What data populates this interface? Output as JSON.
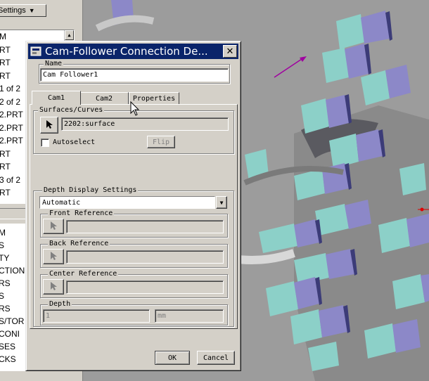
{
  "tree": {
    "settings_label": "Settings",
    "items": [
      "M",
      "RT",
      "RT",
      "RT",
      "1 of 2",
      "2 of 2",
      "2.PRT",
      "2.PRT",
      "2.PRT",
      "RT",
      "RT",
      "3 of 2",
      "RT"
    ],
    "lower_items": [
      "M",
      "S",
      "TY",
      "CTION",
      "RS",
      "S",
      "RS",
      "S/TOR",
      "CONI",
      "SES",
      "CKS"
    ]
  },
  "dialog": {
    "title": "Cam-Follower Connection De...",
    "name_label": "Name",
    "name_value": "Cam Follower1",
    "tabs": [
      "Cam1",
      "Cam2",
      "Properties"
    ],
    "surfaces_label": "Surfaces/Curves",
    "surface_value": "2202:surface",
    "autoselect_label": "Autoselect",
    "flip_label": "Flip",
    "depth_display_label": "Depth Display Settings",
    "depth_display_value": "Automatic",
    "front_ref_label": "Front Reference",
    "back_ref_label": "Back Reference",
    "center_ref_label": "Center Reference",
    "depth_label": "Depth",
    "depth_value": "1",
    "depth_unit": "mm",
    "ok_label": "OK",
    "cancel_label": "Cancel"
  },
  "colors": {
    "titlebar": "#0a246a",
    "viewport_bg": "#9c9c9c",
    "model_light": "#8cd0c8",
    "model_purple": "#8c88c8",
    "model_dark": "#3c3c78"
  },
  "icons": [
    "select-arrow-icon",
    "dropdown-arrow-icon",
    "close-icon",
    "app-icon",
    "mouse-cursor-icon"
  ]
}
